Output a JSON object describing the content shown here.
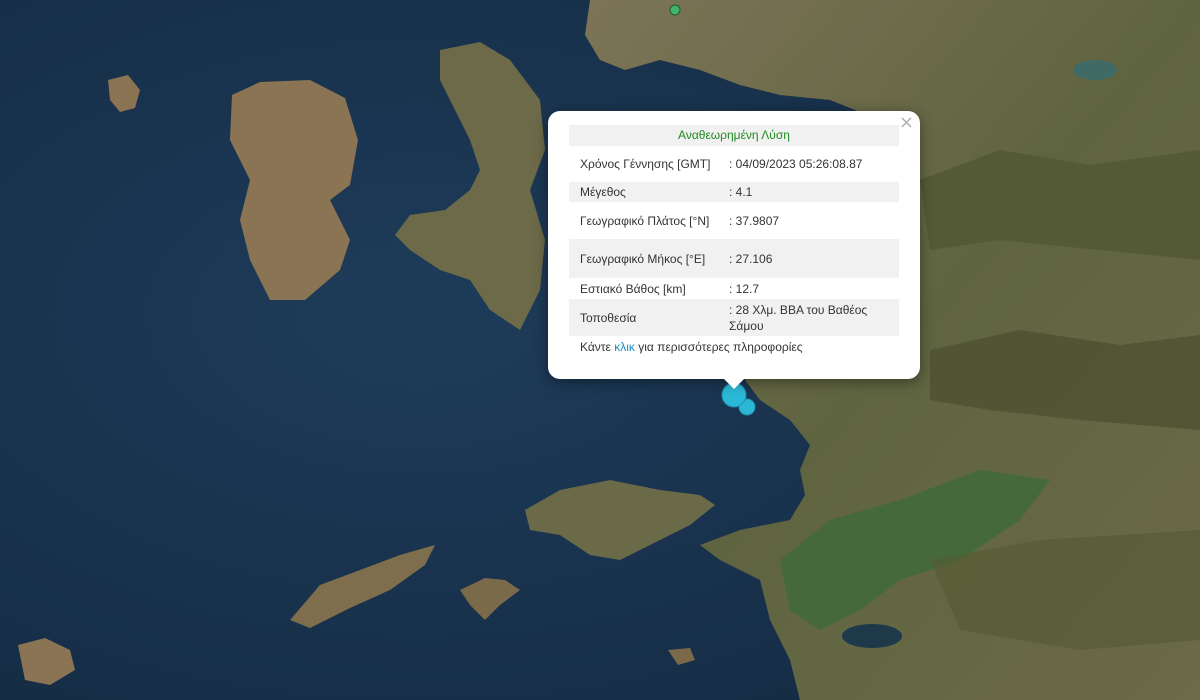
{
  "popup": {
    "title": "Αναθεωρημένη Λύση",
    "close_icon": "×",
    "rows": [
      {
        "label": "Χρόνος Γέννησης [GMT]",
        "value": ": 04/09/2023 05:26:08.87"
      },
      {
        "label": "Μέγεθος",
        "value": ": 4.1"
      },
      {
        "label": "Γεωγραφικό Πλάτος [°N]",
        "value": ": 37.9807"
      },
      {
        "label": "Γεωγραφικό Μήκος [°E]",
        "value": ": 27.106"
      },
      {
        "label": "Εστιακό Βάθος [km]",
        "value": ": 12.7"
      },
      {
        "label": "Τοποθεσία",
        "value": ": 28 Χλμ. ΒΒΑ του Βαθέος Σάμου"
      }
    ],
    "click_prefix": "Κάντε ",
    "click_link": "κλικ",
    "click_suffix": " για περισσότερες πληροφορίες"
  },
  "markers": [
    {
      "name": "earthquake-marker-main",
      "magnitude": 4.1,
      "color": "#2bb8d6"
    },
    {
      "name": "earthquake-marker-secondary",
      "color": "#2bb8d6"
    },
    {
      "name": "station-marker",
      "color": "#3fb46a"
    }
  ],
  "colors": {
    "sea": "#1a3550",
    "land": "#6e6a4a",
    "popup_title": "#1f8a1f",
    "link": "#1a8fc0"
  }
}
